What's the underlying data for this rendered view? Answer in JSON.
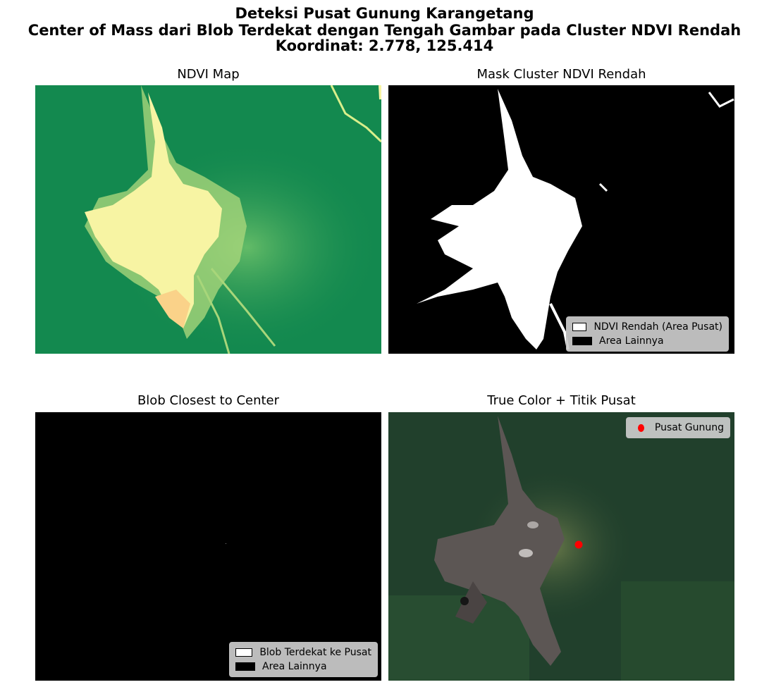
{
  "figure": {
    "title_line1": "Deteksi Pusat Gunung Karangetang",
    "title_line2": "Center of Mass dari Blob Terdekat dengan Tengah Gambar pada Cluster NDVI Rendah",
    "title_line3": "Koordinat: 2.778, 125.414"
  },
  "panels": {
    "ndvi": {
      "title": "NDVI Map",
      "colormap": "RdYlGn"
    },
    "mask": {
      "title": "Mask Cluster NDVI Rendah",
      "legend": [
        "NDVI Rendah (Area Pusat)",
        "Area Lainnya"
      ]
    },
    "blob": {
      "title": "Blob Closest to Center",
      "legend": [
        "Blob Terdekat ke Pusat",
        "Area Lainnya"
      ]
    },
    "truecolor": {
      "title": "True Color + Titik Pusat",
      "legend": [
        "Pusat Gunung"
      ],
      "marker_color": "#ff0000"
    }
  },
  "colors": {
    "vegetation_green": "#13894f",
    "low_ndvi_yellow": "#f7f4a3",
    "mask_white": "#ffffff",
    "mask_black": "#000000",
    "forest_dark": "#21402c",
    "lava_gray": "#5c5654"
  }
}
